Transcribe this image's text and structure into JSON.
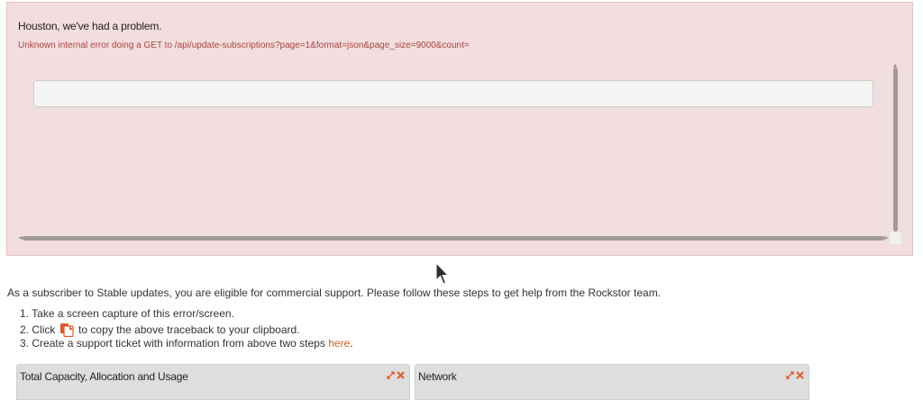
{
  "error": {
    "title": "Houston, we've had a problem.",
    "detail": "Unknown internal error doing a GET to /api/update-subscriptions?page=1&format=json&page_size=9000&count=",
    "traceback": ""
  },
  "support": {
    "intro": "As a subscriber to Stable updates, you are eligible for commercial support. Please follow these steps to get help from the Rockstor team.",
    "steps": [
      {
        "number": "1.",
        "text": "Take a screen capture of this error/screen."
      },
      {
        "number": "2.",
        "before": "Click",
        "after": "to copy the above traceback to your clipboard.",
        "icon": "copy-icon"
      },
      {
        "number": "3.",
        "before": "Create a support ticket with information from above two steps",
        "link": "here",
        "after": "."
      }
    ]
  },
  "widgets": [
    {
      "title": "Total Capacity, Allocation and Usage",
      "icons": [
        "expand-icon",
        "close-icon"
      ]
    },
    {
      "title": "Network",
      "icons": [
        "expand-icon",
        "close-icon"
      ]
    }
  ],
  "colors": {
    "error_bg": "#f2dede",
    "error_text": "#a94442",
    "link": "#e2572b",
    "widget_header": "#dedede"
  }
}
